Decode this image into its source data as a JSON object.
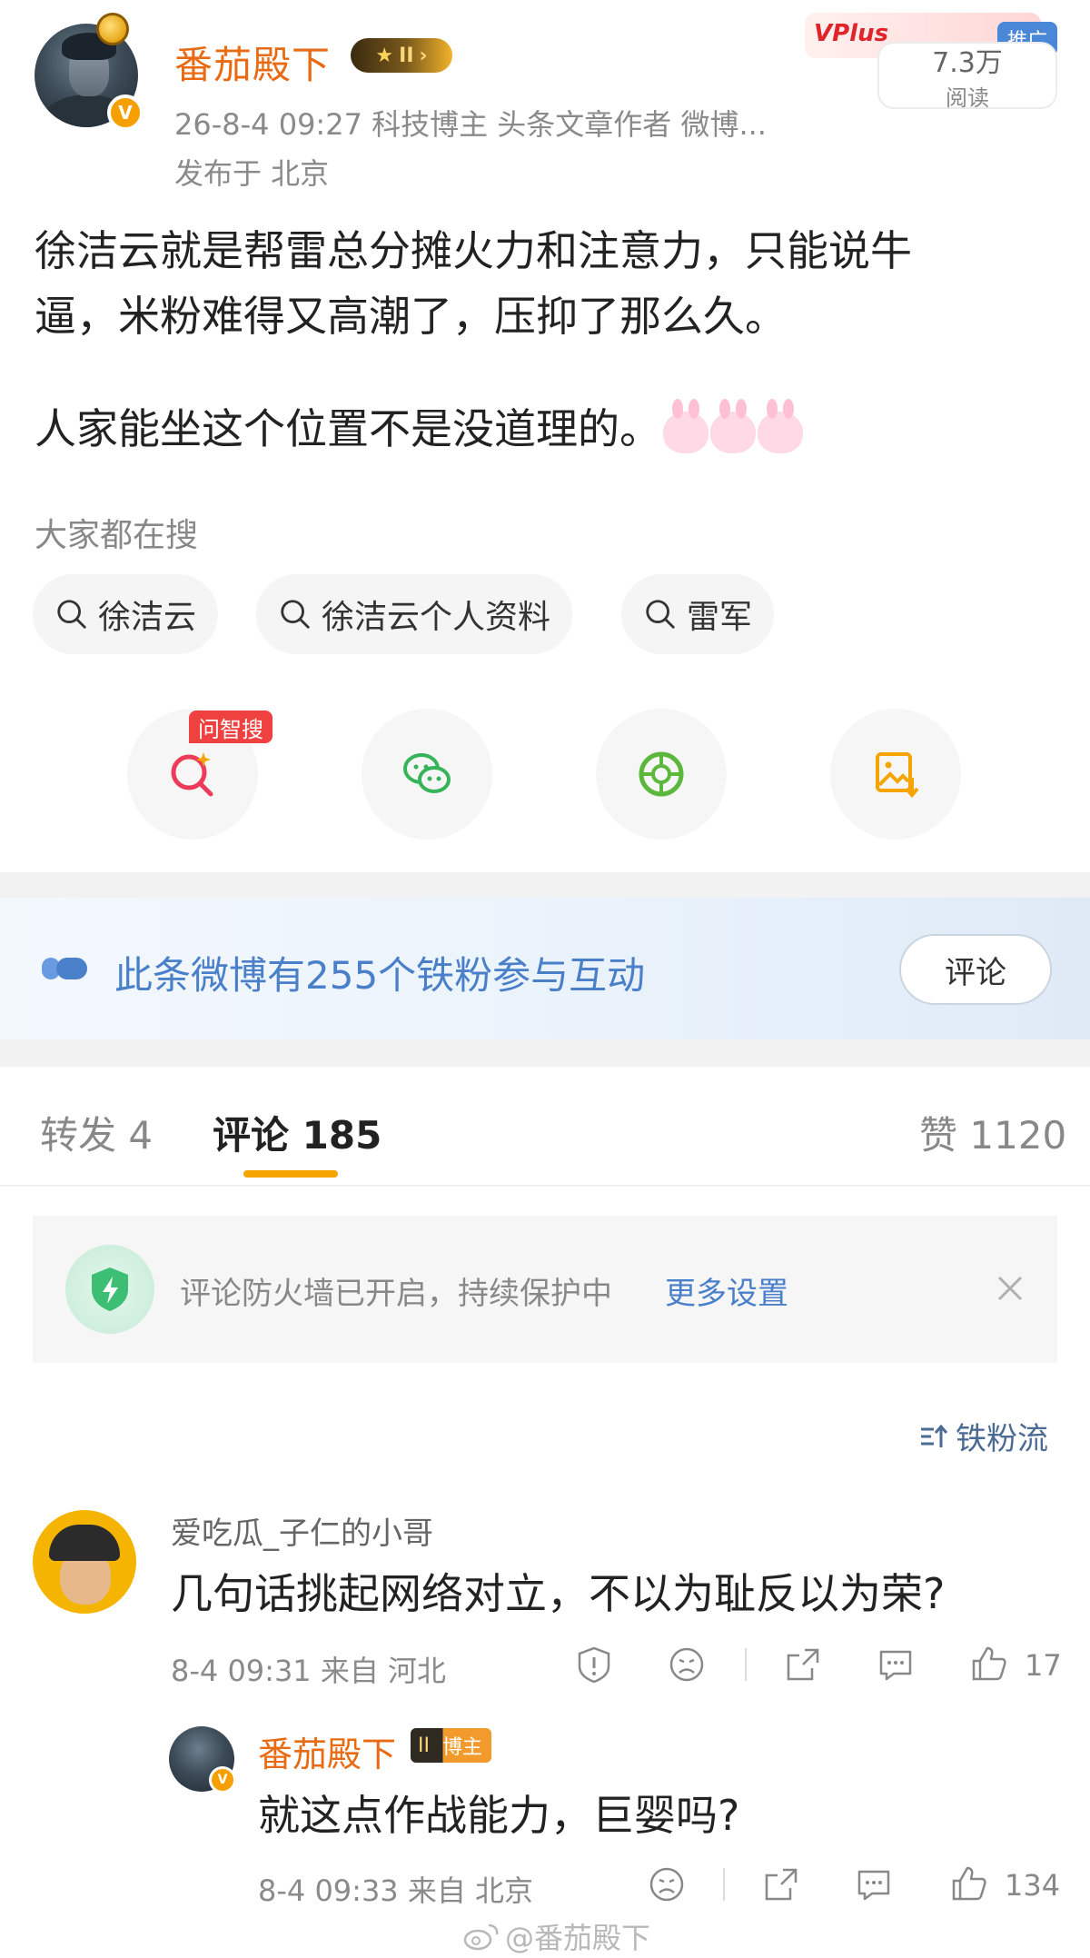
{
  "post": {
    "author": "番茄殿下",
    "level_badge": "II",
    "meta": "26-8-4 09:27  科技博主 头条文章作者 微博...",
    "location": "发布于 北京",
    "ad_label": "推广",
    "promo_text": "VPlus",
    "read_count": "7.3万",
    "read_label": "阅读",
    "text_lines": [
      "徐洁云就是帮雷总分摊火力和注意力，只能说牛",
      "逼，米粉难得又高潮了，压抑了那么久。"
    ],
    "text_line3": "人家能坐这个位置不是没道理的。"
  },
  "search": {
    "hint": "大家都在搜",
    "chips": [
      "徐洁云",
      "徐洁云个人资料",
      "雷军"
    ]
  },
  "share": {
    "wen_tag": "问智搜",
    "icons": [
      "ai-search-icon",
      "wechat-icon",
      "moments-icon",
      "save-image-icon"
    ]
  },
  "fans": {
    "text": "此条微博有255个铁粉参与互动",
    "button": "评论"
  },
  "tabs": {
    "repost": "转发 4",
    "comment": "评论 185",
    "like": "赞 1120"
  },
  "firewall": {
    "text": "评论防火墙已开启，持续保护中",
    "link": "更多设置"
  },
  "sort": {
    "label": "铁粉流"
  },
  "comments": [
    {
      "name": "爱吃瓜_子仁的小哥",
      "text": "几句话挑起网络对立，不以为耻反以为荣?",
      "meta": "8-4 09:31  来自 河北",
      "likes": "17"
    }
  ],
  "reply": {
    "name": "番茄殿下",
    "badge_level": "II",
    "badge_label": "博主",
    "text": "就这点作战能力，巨婴吗?",
    "meta": "8-4 09:33  来自 北京",
    "likes": "134"
  },
  "watermark": "@番茄殿下",
  "colors": {
    "accent_orange": "#e86b14",
    "link_blue": "#4a7fc9",
    "tab_underline": "#f5a400"
  }
}
